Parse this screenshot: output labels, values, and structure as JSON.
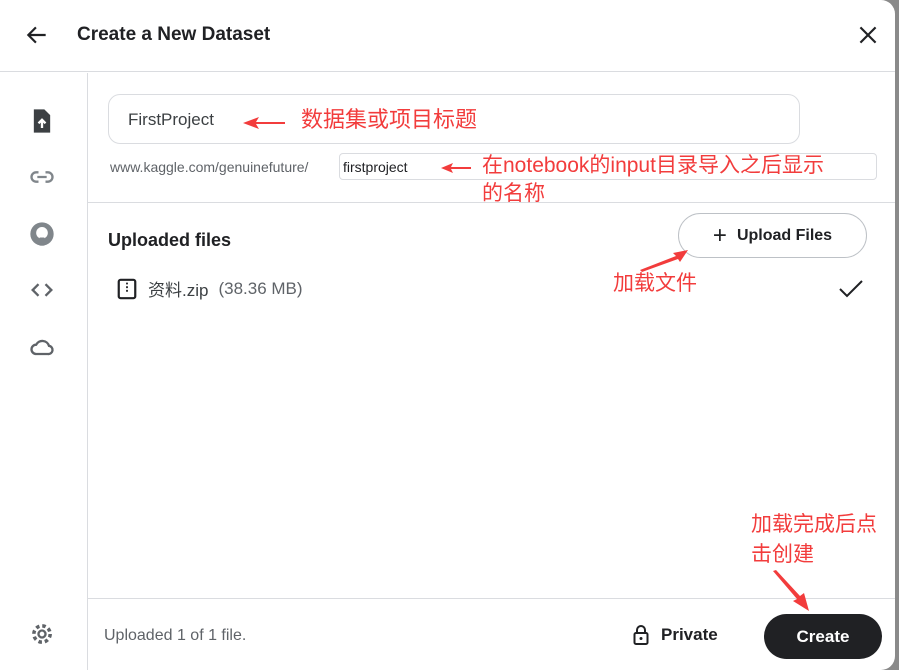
{
  "header": {
    "title": "Create a New Dataset"
  },
  "form": {
    "title_value": "FirstProject",
    "url_prefix": "www.kaggle.com/genuinefuture/",
    "slug_value": "firstproject"
  },
  "files": {
    "heading": "Uploaded files",
    "upload_label": "Upload Files",
    "items": [
      {
        "name": "资料.zip",
        "size": "(38.36 MB)"
      }
    ]
  },
  "footer": {
    "status": "Uploaded 1 of 1 file.",
    "visibility": "Private",
    "create_label": "Create"
  },
  "annotations": {
    "title_note": "数据集或项目标题",
    "slug_note_1": "在notebook的input目录导入之后显示",
    "slug_note_2": "的名称",
    "upload_note": "加载文件",
    "create_note_1": "加载完成后点",
    "create_note_2": "击创建"
  },
  "colors": {
    "annotation": "#f23c3c",
    "primary_button": "#202124"
  }
}
